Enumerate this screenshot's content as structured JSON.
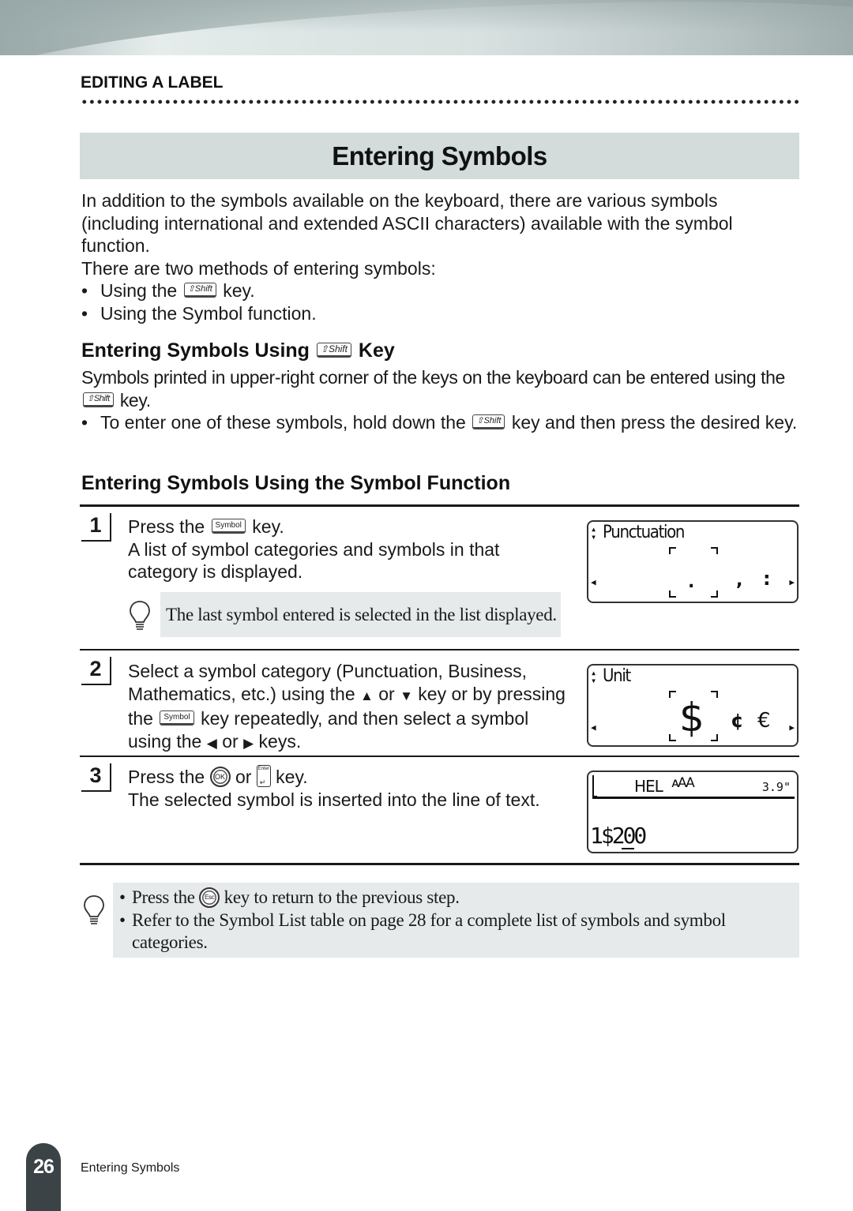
{
  "header": {
    "section_label": "EDITING A LABEL",
    "page_title": "Entering Symbols"
  },
  "intro": {
    "paragraph": "In addition to the symbols available on the keyboard, there are various symbols (including international and extended ASCII characters) available with the symbol function.",
    "methods_lead": "There are two methods of entering symbols:",
    "methods": [
      {
        "before": "Using the",
        "key": "⇧Shift",
        "after": "key."
      },
      {
        "text": "Using the Symbol function."
      }
    ]
  },
  "shift_section": {
    "heading_before": "Entering Symbols Using",
    "heading_key": "⇧Shift",
    "heading_after": "Key",
    "paragraph_before": "Symbols printed in upper-right corner of the keys on the keyboard can be entered using the",
    "paragraph_key": "⇧Shift",
    "paragraph_after": "key.",
    "bullet_before": "To enter one of these symbols, hold down the",
    "bullet_key": "⇧Shift",
    "bullet_after": "key and then press the desired key."
  },
  "symbol_section": {
    "heading": "Entering Symbols Using the Symbol Function",
    "steps": [
      {
        "number": "1",
        "line1_before": "Press the",
        "line1_key": "Symbol",
        "line1_after": "key.",
        "detail": "A list of symbol categories and symbols in that category is displayed.",
        "note": "The last symbol entered is selected in the list displayed.",
        "lcd": {
          "category": "Punctuation",
          "symbols": [
            ".",
            ",",
            ":"
          ],
          "selected": "."
        }
      },
      {
        "number": "2",
        "text_a": "Select a symbol category (Punctuation, Business, Mathematics, etc.) using the",
        "up_key": "▲",
        "or1": "or",
        "down_key": "▼",
        "text_b": "key or by pressing the",
        "key": "Symbol",
        "text_c": "key repeatedly, and then select a symbol using the",
        "left_key": "◀",
        "or2": "or",
        "right_key": "▶",
        "text_d": "keys.",
        "lcd": {
          "category": "Unit",
          "symbols": [
            "$",
            "¢",
            "€"
          ],
          "selected": "$"
        }
      },
      {
        "number": "3",
        "line1_before": "Press the",
        "ok_key": "OK",
        "or": "or",
        "enter_key": "Enter",
        "line1_after": "key.",
        "detail": "The selected symbol is inserted into the line of text.",
        "lcd": {
          "font": "HEL",
          "size_icon": "ᴀAA",
          "length": "3.9\"",
          "text_line": "1$200"
        }
      }
    ]
  },
  "tips": {
    "items": [
      {
        "before": "Press the",
        "key": "Esc",
        "after": "key to return to the previous step."
      },
      {
        "text": "Refer to the Symbol List table on page 28 for a complete list of symbols and symbol categories."
      }
    ]
  },
  "footer": {
    "page_number": "26",
    "title": "Entering Symbols"
  }
}
